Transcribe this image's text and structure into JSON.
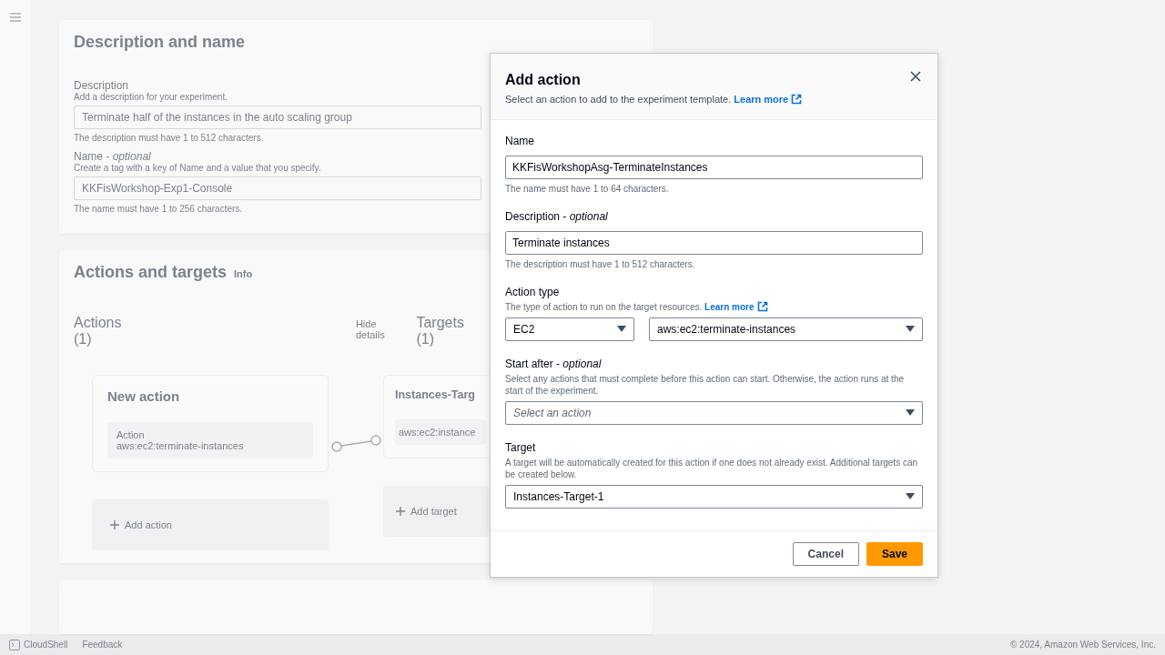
{
  "background": {
    "description_panel": {
      "title": "Description and name",
      "fields": [
        {
          "label": "Description",
          "description": "Add a description for your experiment.",
          "value": "Terminate half of the instances in the auto scaling group",
          "hint": "The description must have 1 to 512 characters."
        },
        {
          "label": "Name - *optional*",
          "description": "Create a tag with a key of Name and a value that you specify.",
          "value": "KKFisWorkshop-Exp1-Console",
          "hint": "The name must have 1 to 256 characters."
        }
      ]
    },
    "actions_panel": {
      "title": "Actions and targets",
      "info": "Info",
      "actions_heading": "Actions (1)",
      "hide_details": "Hide details",
      "targets_heading": "Targets (1)",
      "action_card": {
        "title": "New action",
        "label": "Action",
        "value": "aws:ec2:terminate-instances"
      },
      "target_card": {
        "title": "Instances-Targ",
        "value": "aws:ec2:instance"
      },
      "add_action": "Add action",
      "add_target": "Add target"
    },
    "footer": {
      "links": [
        "CloudShell",
        "Feedback"
      ],
      "copyright": "© 2024, Amazon Web Services, Inc."
    }
  },
  "modal": {
    "title": "Add action",
    "subtitle": "Select an action to add to the experiment template.",
    "learn_more": "Learn more",
    "fields": [
      {
        "kind": "text",
        "label": "Name",
        "value": "KKFisWorkshopAsg-TerminateInstances",
        "hint": "The name must have 1 to 64 characters."
      },
      {
        "kind": "text",
        "label": "Description - *optional*",
        "value": "Terminate instances",
        "hint": "The description must have 1 to 512 characters."
      },
      {
        "kind": "select_pair",
        "label": "Action type",
        "description": "The type of action to run on the target resources.",
        "learn_more": "Learn more",
        "selects": [
          {
            "value": "EC2"
          },
          {
            "value": "aws:ec2:terminate-instances"
          }
        ]
      },
      {
        "kind": "select",
        "label": "Start after - *optional*",
        "description": "Select any actions that must complete before this action can start. Otherwise, the action runs at the start of the experiment.",
        "placeholder": "Select an action"
      },
      {
        "kind": "select",
        "label": "Target",
        "description": "A target will be automatically created for this action if one does not already exist. Additional targets can be created below.",
        "value": "Instances-Target-1"
      }
    ],
    "buttons": [
      {
        "label": "Cancel",
        "kind": "secondary"
      },
      {
        "label": "Save",
        "kind": "primary"
      }
    ]
  }
}
